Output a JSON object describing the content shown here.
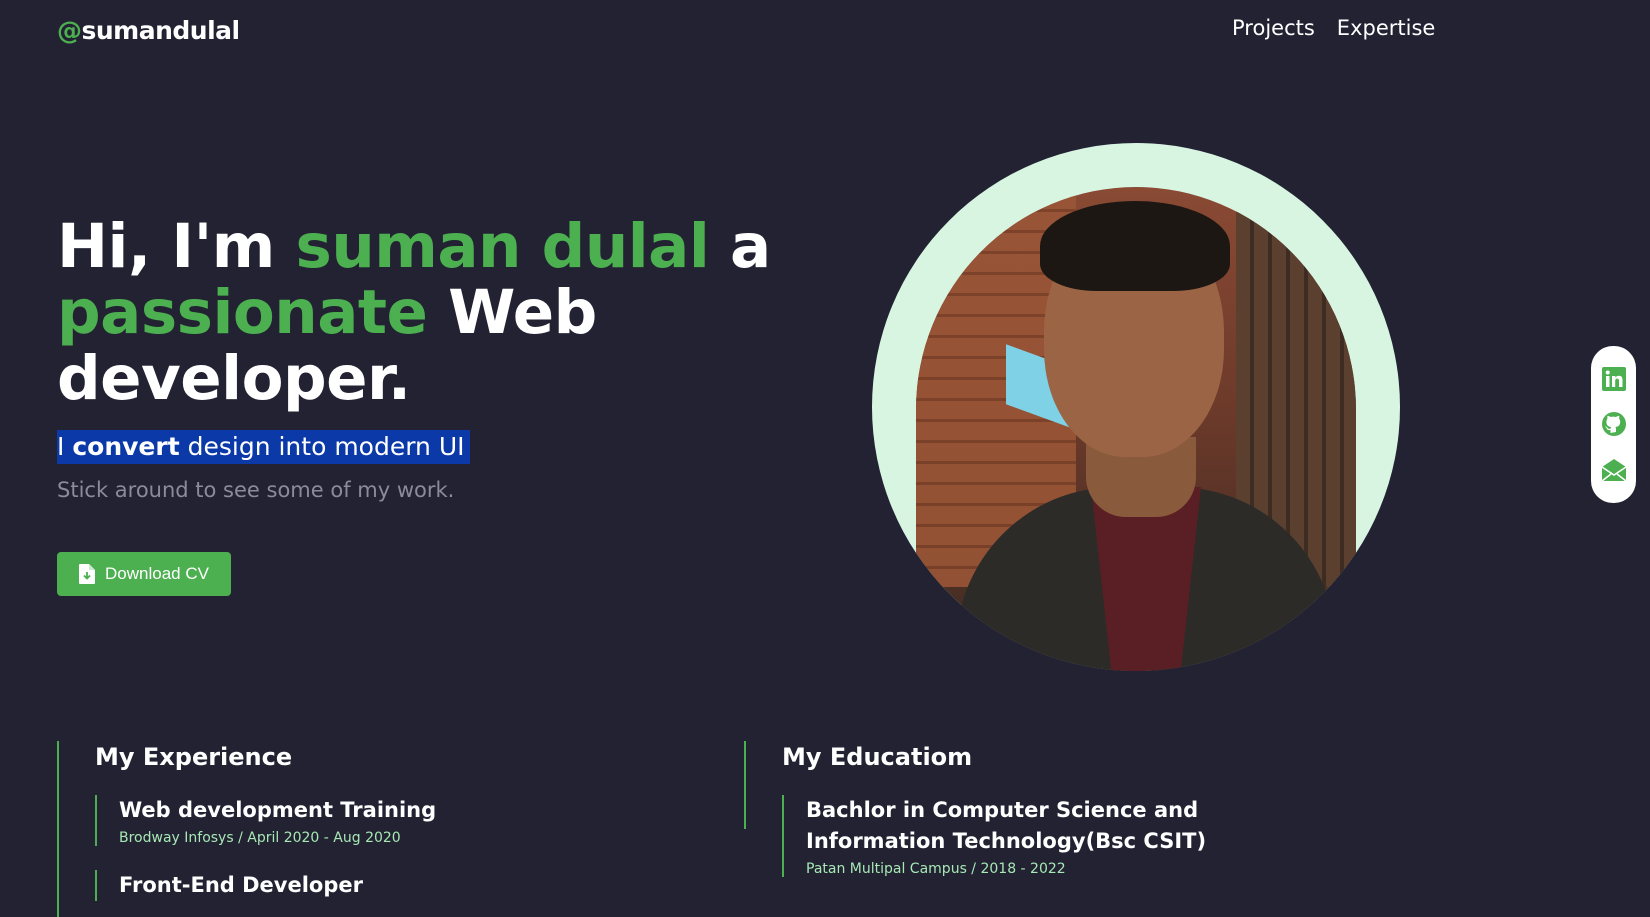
{
  "nav": {
    "logo_at": "@",
    "logo_name": "sumandulal",
    "links": [
      "Projects",
      "Expertise"
    ]
  },
  "hero": {
    "title_1": "Hi, I'm ",
    "title_name": "suman dulal",
    "title_2": " a",
    "title_passionate": "passionate",
    "title_3": " Web developer.",
    "tagline_pre": "I ",
    "tagline_bold": "convert",
    "tagline_post": " design into modern UI",
    "sub": "Stick around to see some of my work.",
    "cv_label": "Download CV"
  },
  "social": [
    "linkedin-icon",
    "github-icon",
    "email-icon"
  ],
  "experience": {
    "heading": "My Experience",
    "items": [
      {
        "title": "Web development Training",
        "meta": "Brodway Infosys / April 2020 - Aug 2020"
      },
      {
        "title": "Front-End Developer",
        "meta": ""
      }
    ]
  },
  "education": {
    "heading": "My Educatiom",
    "items": [
      {
        "title": "Bachlor in Computer Science and Information Technology(Bsc CSIT)",
        "meta": "Patan Multipal Campus / 2018 - 2022"
      }
    ]
  },
  "colors": {
    "background": "#222232",
    "accent": "#4caf50",
    "highlight": "#0b3aa8",
    "ring": "#d8f5e2"
  }
}
